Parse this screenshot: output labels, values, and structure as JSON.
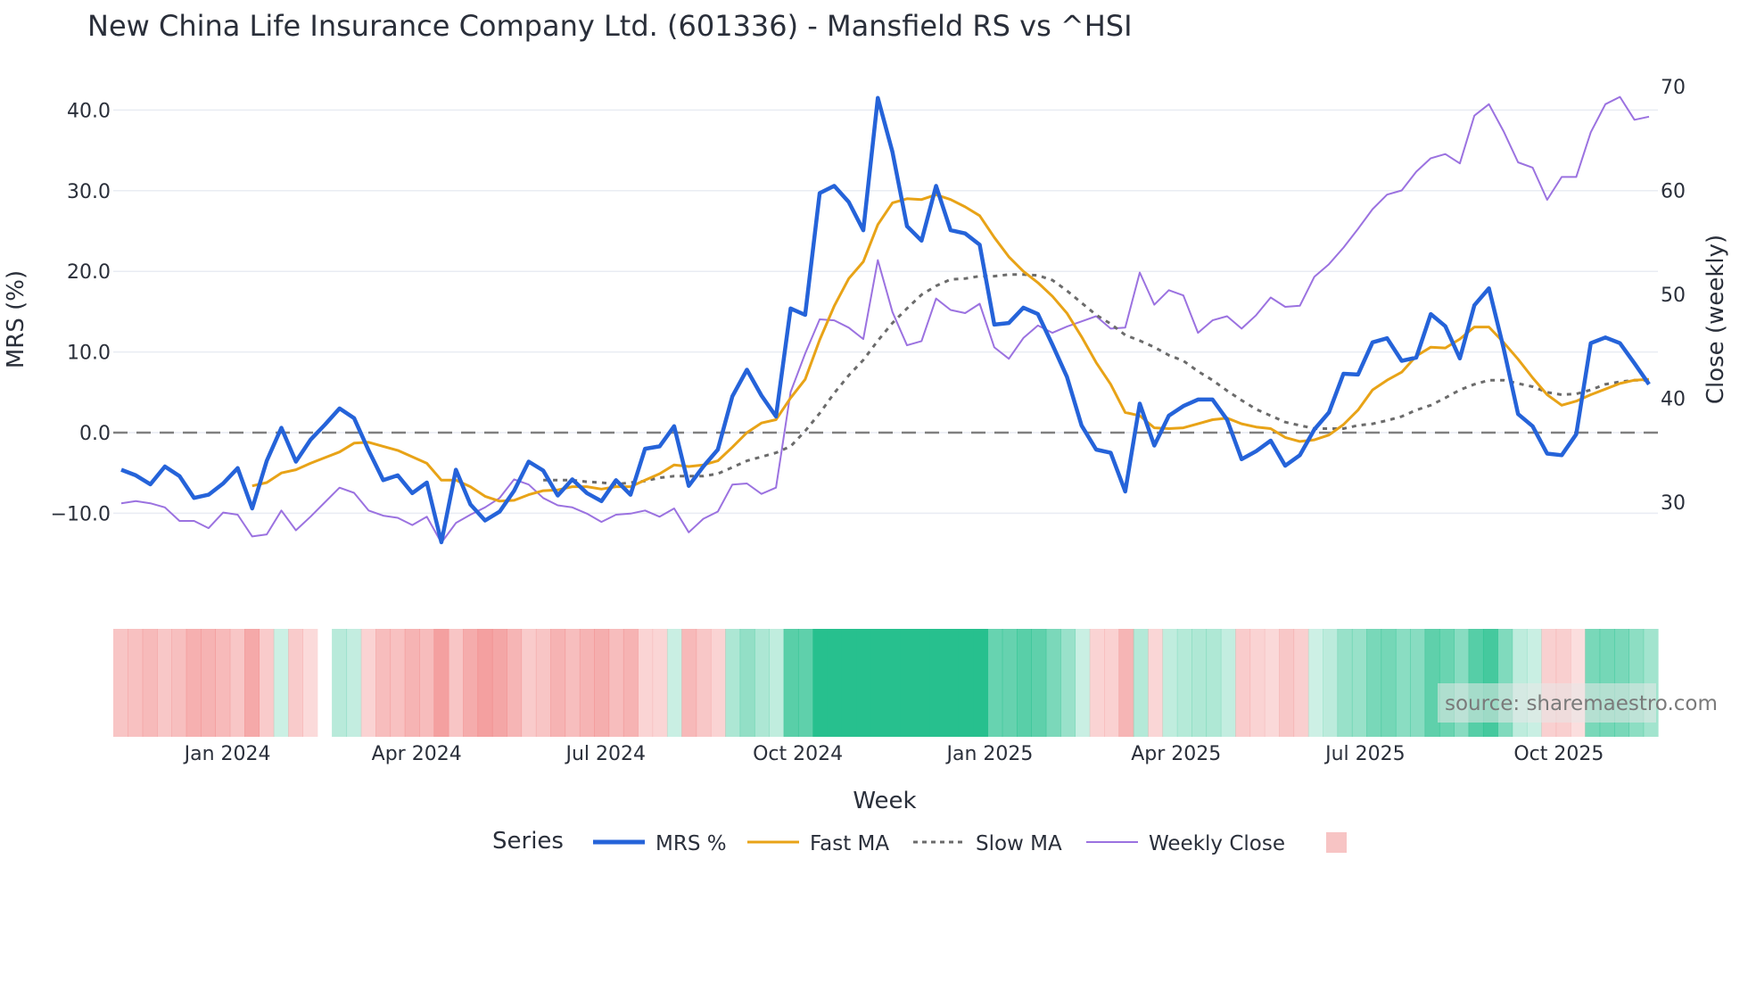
{
  "chart_data": {
    "type": "line",
    "title": "New China Life Insurance Company Ltd. (601336) - Mansfield RS vs ^HSI",
    "xlabel": "Week",
    "ylabel": "MRS (%)",
    "y2label": "Close (weekly)",
    "ylim": [
      -12.5,
      43
    ],
    "y2lim": [
      24.5,
      72
    ],
    "yticks": [
      "40.0",
      "30.0",
      "20.0",
      "10.0",
      "0.0",
      "−10.0"
    ],
    "ytick_values": [
      40,
      30,
      20,
      10,
      0,
      -10
    ],
    "y2ticks": [
      "70",
      "60",
      "50",
      "40",
      "30"
    ],
    "y2tick_values": [
      70,
      60,
      50,
      40,
      30
    ],
    "xticks": [
      "Jan 2024",
      "Apr 2024",
      "Jul 2024",
      "Oct 2024",
      "Jan 2025",
      "Apr 2025",
      "Jul 2025",
      "Oct 2025"
    ],
    "xtick_week_index": [
      7.3,
      20.3,
      33.3,
      46.5,
      59.7,
      72.5,
      85.5,
      98.8
    ],
    "weeks": 106,
    "zero_line": 0,
    "grid": true,
    "legend_title": "Series",
    "legend_placement": "bottom-center",
    "annotation": "source: sharemaestro.com",
    "colors": {
      "mrs": "#2563d9",
      "fast": "#e8a317",
      "slow": "#6b6b6b",
      "close": "#9b72e0",
      "pos": "#27c08e",
      "neg": "#f08080"
    },
    "series": [
      {
        "name": "MRS %",
        "axis": "left",
        "values": [
          -4.6,
          -5.3,
          -6.4,
          -4.2,
          -5.4,
          -8.1,
          -7.7,
          -6.3,
          -4.4,
          -9.4,
          -3.5,
          0.6,
          -3.6,
          -0.9,
          1.0,
          3.0,
          1.8,
          -2.2,
          -5.9,
          -5.3,
          -7.5,
          -6.2,
          -13.6,
          -4.6,
          -8.9,
          -10.9,
          -9.8,
          -7.2,
          -3.6,
          -4.7,
          -7.8,
          -5.8,
          -7.5,
          -8.5,
          -5.9,
          -7.7,
          -2.0,
          -1.7,
          0.8,
          -6.6,
          -4.2,
          -2.1,
          4.5,
          7.8,
          4.6,
          2.0,
          15.4,
          14.6,
          29.7,
          30.6,
          28.6,
          25.1,
          41.5,
          34.8,
          25.6,
          23.8,
          30.6,
          25.1,
          24.7,
          23.3,
          13.4,
          13.6,
          15.5,
          14.7,
          10.9,
          6.9,
          0.9,
          -2.1,
          -2.5,
          -7.3,
          3.6,
          -1.6,
          2.1,
          3.3,
          4.1,
          4.1,
          1.6,
          -3.3,
          -2.3,
          -1.0,
          -4.1,
          -2.8,
          0.4,
          2.5,
          7.3,
          7.2,
          11.2,
          11.7,
          8.9,
          9.3,
          14.7,
          13.2,
          9.2,
          15.8,
          17.9,
          10.5,
          2.3,
          0.8,
          -2.6,
          -2.8,
          -0.2,
          11.1,
          11.8,
          11.1,
          8.6,
          6.0
        ]
      },
      {
        "name": "Fast MA",
        "axis": "left",
        "values": [
          -6.6,
          -6.2,
          -5.0,
          -4.6,
          -3.8,
          -3.1,
          -2.4,
          -1.3,
          -1.2,
          -1.7,
          -2.2,
          -3.0,
          -3.8,
          -5.9,
          -5.9,
          -6.7,
          -7.9,
          -8.5,
          -8.4,
          -7.7,
          -7.2,
          -7.1,
          -6.7,
          -6.7,
          -7.0,
          -6.7,
          -6.7,
          -5.9,
          -5.1,
          -4.0,
          -4.2,
          -4.0,
          -3.5,
          -1.8,
          0.0,
          1.2,
          1.6,
          4.3,
          6.6,
          11.5,
          15.7,
          19.1,
          21.2,
          25.8,
          28.5,
          29.0,
          28.9,
          29.5,
          28.9,
          28.0,
          26.9,
          24.2,
          21.8,
          20.0,
          18.6,
          16.9,
          14.8,
          11.9,
          8.7,
          6.0,
          2.5,
          2.1,
          0.6,
          0.5,
          0.6,
          1.1,
          1.6,
          1.8,
          1.1,
          0.7,
          0.5,
          -0.6,
          -1.1,
          -0.9,
          -0.3,
          1.0,
          2.8,
          5.3,
          6.5,
          7.5,
          9.5,
          10.6,
          10.5,
          11.6,
          13.1,
          13.1,
          11.2,
          9.1,
          6.8,
          4.7,
          3.4,
          3.9,
          4.7,
          5.4,
          6.1,
          6.5,
          6.6
        ]
      },
      {
        "name": "Slow MA",
        "axis": "left",
        "values": [
          -5.9,
          -5.9,
          -5.9,
          -6.1,
          -6.2,
          -6.4,
          -6.2,
          -6.0,
          -5.6,
          -5.4,
          -5.4,
          -5.4,
          -5.1,
          -4.3,
          -3.5,
          -3.0,
          -2.5,
          -1.7,
          0.2,
          2.4,
          4.9,
          7.1,
          9.0,
          11.4,
          13.6,
          15.4,
          17.1,
          18.2,
          19.0,
          19.1,
          19.4,
          19.4,
          19.6,
          19.6,
          19.5,
          18.9,
          17.6,
          16.1,
          14.6,
          13.5,
          12.1,
          11.4,
          10.6,
          9.6,
          8.9,
          7.6,
          6.5,
          5.2,
          4.0,
          2.9,
          2.1,
          1.3,
          0.9,
          0.5,
          0.5,
          0.5,
          0.9,
          1.1,
          1.5,
          2.0,
          2.8,
          3.4,
          4.3,
          5.3,
          6.0,
          6.5,
          6.5,
          6.1,
          5.7,
          5.0,
          4.7,
          4.8,
          5.3,
          6.0,
          6.3,
          6.5,
          6.5
        ]
      },
      {
        "name": "Weekly Close",
        "axis": "right",
        "values": [
          29.9,
          30.1,
          29.9,
          29.5,
          28.2,
          28.2,
          27.5,
          29.0,
          28.8,
          26.7,
          26.9,
          29.2,
          27.3,
          28.6,
          30.0,
          31.4,
          30.9,
          29.2,
          28.7,
          28.5,
          27.8,
          28.6,
          26.1,
          28.0,
          28.8,
          29.5,
          30.4,
          32.2,
          31.7,
          30.4,
          29.7,
          29.5,
          28.9,
          28.1,
          28.8,
          28.9,
          29.2,
          28.6,
          29.4,
          27.1,
          28.4,
          29.1,
          31.7,
          31.8,
          30.8,
          31.4,
          40.6,
          44.3,
          47.6,
          47.5,
          46.8,
          45.7,
          53.3,
          48.3,
          45.1,
          45.5,
          49.6,
          48.5,
          48.2,
          49.1,
          44.9,
          43.8,
          45.8,
          47.0,
          46.3,
          46.9,
          47.4,
          47.9,
          46.7,
          46.8,
          52.1,
          49.0,
          50.4,
          49.9,
          46.3,
          47.5,
          47.9,
          46.7,
          48.0,
          49.7,
          48.8,
          48.9,
          51.7,
          52.9,
          54.5,
          56.3,
          58.2,
          59.6,
          60.0,
          61.8,
          63.1,
          63.5,
          62.6,
          67.2,
          68.3,
          65.7,
          62.7,
          62.2,
          59.1,
          61.3,
          61.3,
          65.6,
          68.3,
          69.0,
          66.8,
          67.1
        ]
      }
    ],
    "heatmap": {
      "source": "MRS %",
      "missing_week_index": [
        14
      ]
    }
  }
}
